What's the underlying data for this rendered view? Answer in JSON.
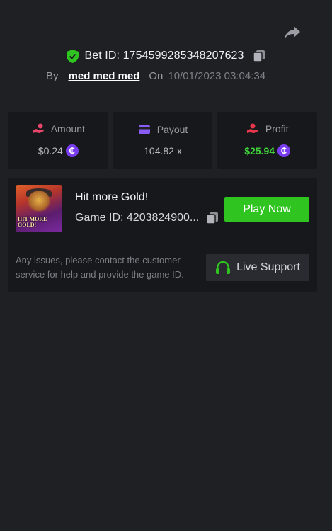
{
  "header": {
    "share_icon": "share-arrow-icon",
    "bet_id": "Bet ID: 1754599285348207623",
    "by_label": "By",
    "username": "med med med",
    "on_label": "On",
    "date": "10/01/2023 03:04:34"
  },
  "stats": {
    "amount": {
      "label": "Amount",
      "value": "$0.24",
      "icon": "coins-hand-icon",
      "color": "#e8456a"
    },
    "payout": {
      "label": "Payout",
      "value": "104.82 x",
      "icon": "card-icon",
      "color": "#8a5cf6"
    },
    "profit": {
      "label": "Profit",
      "value": "$25.94",
      "icon": "money-hand-icon",
      "color": "#e8364a",
      "value_color": "#3fd13a"
    },
    "coin_symbol": "₵"
  },
  "game": {
    "thumbnail_text_line1": "HIT MORE",
    "thumbnail_text_line2": "GOLD!",
    "title": "Hit more Gold!",
    "game_id": "Game ID: 4203824900...",
    "play_label": "Play Now",
    "help_text": "Any issues, please contact the customer service for help and provide the game ID.",
    "support_label": "Live Support",
    "accent_green": "#2fc41f"
  }
}
